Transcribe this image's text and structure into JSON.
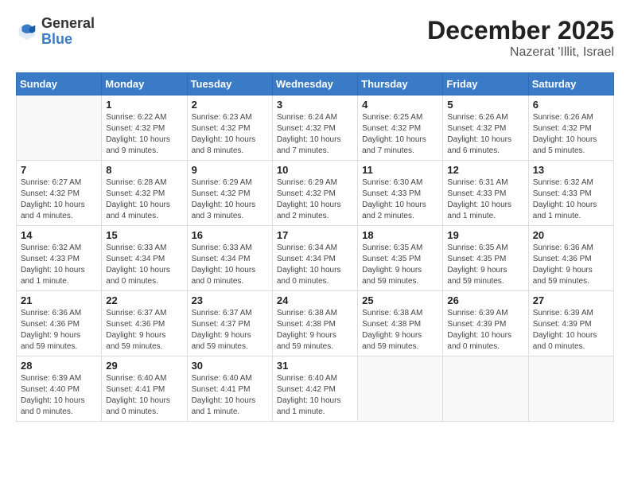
{
  "logo": {
    "general": "General",
    "blue": "Blue"
  },
  "title": "December 2025",
  "subtitle": "Nazerat 'Illit, Israel",
  "weekdays": [
    "Sunday",
    "Monday",
    "Tuesday",
    "Wednesday",
    "Thursday",
    "Friday",
    "Saturday"
  ],
  "weeks": [
    [
      {
        "day": "",
        "info": ""
      },
      {
        "day": "1",
        "info": "Sunrise: 6:22 AM\nSunset: 4:32 PM\nDaylight: 10 hours\nand 9 minutes."
      },
      {
        "day": "2",
        "info": "Sunrise: 6:23 AM\nSunset: 4:32 PM\nDaylight: 10 hours\nand 8 minutes."
      },
      {
        "day": "3",
        "info": "Sunrise: 6:24 AM\nSunset: 4:32 PM\nDaylight: 10 hours\nand 7 minutes."
      },
      {
        "day": "4",
        "info": "Sunrise: 6:25 AM\nSunset: 4:32 PM\nDaylight: 10 hours\nand 7 minutes."
      },
      {
        "day": "5",
        "info": "Sunrise: 6:26 AM\nSunset: 4:32 PM\nDaylight: 10 hours\nand 6 minutes."
      },
      {
        "day": "6",
        "info": "Sunrise: 6:26 AM\nSunset: 4:32 PM\nDaylight: 10 hours\nand 5 minutes."
      }
    ],
    [
      {
        "day": "7",
        "info": "Sunrise: 6:27 AM\nSunset: 4:32 PM\nDaylight: 10 hours\nand 4 minutes."
      },
      {
        "day": "8",
        "info": "Sunrise: 6:28 AM\nSunset: 4:32 PM\nDaylight: 10 hours\nand 4 minutes."
      },
      {
        "day": "9",
        "info": "Sunrise: 6:29 AM\nSunset: 4:32 PM\nDaylight: 10 hours\nand 3 minutes."
      },
      {
        "day": "10",
        "info": "Sunrise: 6:29 AM\nSunset: 4:32 PM\nDaylight: 10 hours\nand 2 minutes."
      },
      {
        "day": "11",
        "info": "Sunrise: 6:30 AM\nSunset: 4:33 PM\nDaylight: 10 hours\nand 2 minutes."
      },
      {
        "day": "12",
        "info": "Sunrise: 6:31 AM\nSunset: 4:33 PM\nDaylight: 10 hours\nand 1 minute."
      },
      {
        "day": "13",
        "info": "Sunrise: 6:32 AM\nSunset: 4:33 PM\nDaylight: 10 hours\nand 1 minute."
      }
    ],
    [
      {
        "day": "14",
        "info": "Sunrise: 6:32 AM\nSunset: 4:33 PM\nDaylight: 10 hours\nand 1 minute."
      },
      {
        "day": "15",
        "info": "Sunrise: 6:33 AM\nSunset: 4:34 PM\nDaylight: 10 hours\nand 0 minutes."
      },
      {
        "day": "16",
        "info": "Sunrise: 6:33 AM\nSunset: 4:34 PM\nDaylight: 10 hours\nand 0 minutes."
      },
      {
        "day": "17",
        "info": "Sunrise: 6:34 AM\nSunset: 4:34 PM\nDaylight: 10 hours\nand 0 minutes."
      },
      {
        "day": "18",
        "info": "Sunrise: 6:35 AM\nSunset: 4:35 PM\nDaylight: 9 hours\nand 59 minutes."
      },
      {
        "day": "19",
        "info": "Sunrise: 6:35 AM\nSunset: 4:35 PM\nDaylight: 9 hours\nand 59 minutes."
      },
      {
        "day": "20",
        "info": "Sunrise: 6:36 AM\nSunset: 4:36 PM\nDaylight: 9 hours\nand 59 minutes."
      }
    ],
    [
      {
        "day": "21",
        "info": "Sunrise: 6:36 AM\nSunset: 4:36 PM\nDaylight: 9 hours\nand 59 minutes."
      },
      {
        "day": "22",
        "info": "Sunrise: 6:37 AM\nSunset: 4:36 PM\nDaylight: 9 hours\nand 59 minutes."
      },
      {
        "day": "23",
        "info": "Sunrise: 6:37 AM\nSunset: 4:37 PM\nDaylight: 9 hours\nand 59 minutes."
      },
      {
        "day": "24",
        "info": "Sunrise: 6:38 AM\nSunset: 4:38 PM\nDaylight: 9 hours\nand 59 minutes."
      },
      {
        "day": "25",
        "info": "Sunrise: 6:38 AM\nSunset: 4:38 PM\nDaylight: 9 hours\nand 59 minutes."
      },
      {
        "day": "26",
        "info": "Sunrise: 6:39 AM\nSunset: 4:39 PM\nDaylight: 10 hours\nand 0 minutes."
      },
      {
        "day": "27",
        "info": "Sunrise: 6:39 AM\nSunset: 4:39 PM\nDaylight: 10 hours\nand 0 minutes."
      }
    ],
    [
      {
        "day": "28",
        "info": "Sunrise: 6:39 AM\nSunset: 4:40 PM\nDaylight: 10 hours\nand 0 minutes."
      },
      {
        "day": "29",
        "info": "Sunrise: 6:40 AM\nSunset: 4:41 PM\nDaylight: 10 hours\nand 0 minutes."
      },
      {
        "day": "30",
        "info": "Sunrise: 6:40 AM\nSunset: 4:41 PM\nDaylight: 10 hours\nand 1 minute."
      },
      {
        "day": "31",
        "info": "Sunrise: 6:40 AM\nSunset: 4:42 PM\nDaylight: 10 hours\nand 1 minute."
      },
      {
        "day": "",
        "info": ""
      },
      {
        "day": "",
        "info": ""
      },
      {
        "day": "",
        "info": ""
      }
    ]
  ]
}
